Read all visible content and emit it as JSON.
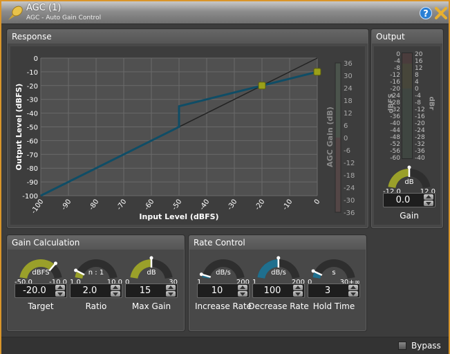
{
  "window": {
    "title": "AGC (1)",
    "subtitle": "AGC - Auto Gain Control",
    "help_icon": "help-icon",
    "close_icon": "close-icon",
    "pin_icon": "pushpin-icon",
    "border_color": "#d9952a"
  },
  "response": {
    "title": "Response"
  },
  "chart_data": {
    "type": "line",
    "xlabel": "Input Level (dBFS)",
    "ylabel": "Output Level (dBFS)",
    "y2label": "AGC Gain (dB)",
    "xlim": [
      -100,
      0
    ],
    "ylim": [
      -100,
      0
    ],
    "y2lim": [
      -36,
      36
    ],
    "xticks": [
      "-100",
      "-90",
      "-80",
      "-70",
      "-60",
      "-50",
      "-40",
      "-30",
      "-20",
      "-10",
      "0"
    ],
    "yticks": [
      "0",
      "-10",
      "-20",
      "-30",
      "-40",
      "-50",
      "-60",
      "-70",
      "-80",
      "-90",
      "-100"
    ],
    "y2ticks": [
      "36",
      "30",
      "24",
      "18",
      "12",
      "6",
      "0",
      "-6",
      "-12",
      "-18",
      "-24",
      "-30",
      "-36"
    ],
    "grid": true,
    "series": [
      {
        "role": "unity reference",
        "color": "#222222",
        "points": [
          [
            -100,
            -100
          ],
          [
            0,
            0
          ]
        ]
      },
      {
        "role": "response curve",
        "color": "#0f4d66",
        "points": [
          [
            -100,
            -100
          ],
          [
            -50,
            -50
          ],
          [
            -50,
            -35
          ],
          [
            -20,
            -20
          ],
          [
            0,
            -10
          ]
        ]
      }
    ],
    "handles": {
      "color": "#9aa019",
      "points": [
        [
          -20,
          -20
        ],
        [
          0,
          -10
        ]
      ]
    }
  },
  "output": {
    "title": "Output",
    "left_label": "dBFS",
    "right_label": "dBr",
    "left_ticks": [
      "0",
      "-4",
      "-8",
      "-12",
      "-16",
      "-20",
      "-24",
      "-28",
      "-32",
      "-36",
      "-40",
      "-44",
      "-48",
      "-52",
      "-56",
      "-60"
    ],
    "right_ticks": [
      "20",
      "16",
      "12",
      "8",
      "4",
      "0",
      "-4",
      "-8",
      "-12",
      "-16",
      "-20",
      "-24",
      "-28",
      "-32",
      "-36",
      "-40"
    ],
    "gain": {
      "label": "Gain",
      "unit": "dB",
      "min_label": "-12.0",
      "max_label": "12.0",
      "min": -12,
      "max": 12,
      "value": "0.0",
      "color": "#9aa02a"
    }
  },
  "gain_calc": {
    "title": "Gain Calculation",
    "knobs": [
      {
        "label": "Target",
        "unit": "dBFS",
        "min_label": "-50.0",
        "max_label": "-10.0",
        "min": -50,
        "max": -10,
        "value": "-20.0",
        "color": "#9aa02a"
      },
      {
        "label": "Ratio",
        "unit": "n : 1",
        "min_label": "1.0",
        "max_label": "10.0",
        "min": 1,
        "max": 10,
        "value": "2.0",
        "color": "#9aa02a"
      },
      {
        "label": "Max Gain",
        "unit": "dB",
        "min_label": "0",
        "max_label": "30",
        "min": 0,
        "max": 30,
        "value": "15",
        "color": "#9aa02a"
      }
    ]
  },
  "rate_control": {
    "title": "Rate Control",
    "knobs": [
      {
        "label": "Increase Rate",
        "unit": "dB/s",
        "min_label": "1",
        "max_label": "200",
        "min": 1,
        "max": 200,
        "value": "10",
        "color": "#1f6f8e"
      },
      {
        "label": "Decrease Rate",
        "unit": "dB/s",
        "min_label": "1",
        "max_label": "200",
        "min": 1,
        "max": 200,
        "value": "100",
        "color": "#1f6f8e"
      },
      {
        "label": "Hold Time",
        "unit": "s",
        "min_label": "0",
        "max_label": "30+∞",
        "min": 0,
        "max": 30,
        "value": "3",
        "color": "#1f6f8e"
      }
    ]
  },
  "status": {
    "bypass_label": "Bypass",
    "bypass_checked": false
  }
}
